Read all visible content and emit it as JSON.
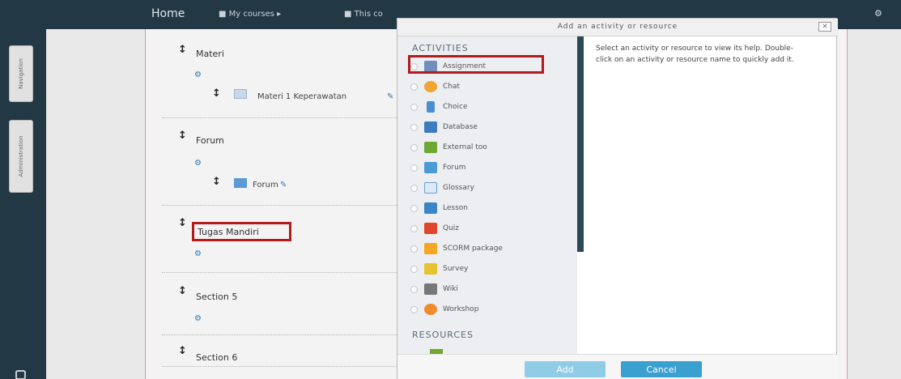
{
  "topnav": {
    "home": "Home",
    "my_courses": "My courses ▸",
    "this_course": "This co",
    "gear_icon": "gear-icon"
  },
  "rail": {
    "navigation_label": "Navigation",
    "administration_label": "Administration"
  },
  "course": {
    "sections": [
      {
        "title": "Materi",
        "item": {
          "label": "Materi 1 Keperawatan",
          "icon": "file-icon"
        }
      },
      {
        "title": "Forum",
        "item": {
          "label": "Forum",
          "icon": "forum-icon"
        }
      },
      {
        "title": "Tugas Mandiri"
      },
      {
        "title": "Section 5"
      },
      {
        "title": "Section 6"
      }
    ]
  },
  "dialog": {
    "title": "Add an activity or resource",
    "close": "✕",
    "activities_heading": "ACTIVITIES",
    "resources_heading": "RESOURCES",
    "activities": [
      {
        "label": "Assignment",
        "icon": "assignment-icon",
        "color": "#6f8fbf",
        "selected": true
      },
      {
        "label": "Chat",
        "icon": "chat-icon",
        "color": "#f0a534"
      },
      {
        "label": "Choice",
        "icon": "choice-icon",
        "color": "#4a8ed0"
      },
      {
        "label": "Database",
        "icon": "database-icon",
        "color": "#3e7cc0"
      },
      {
        "label": "External too",
        "icon": "external-tool-icon",
        "color": "#6ea834"
      },
      {
        "label": "Forum",
        "icon": "forum-icon",
        "color": "#4a9bd6"
      },
      {
        "label": "Glossary",
        "icon": "glossary-icon",
        "color": "#6aa0d8"
      },
      {
        "label": "Lesson",
        "icon": "lesson-icon",
        "color": "#3a86c8"
      },
      {
        "label": "Quiz",
        "icon": "quiz-icon",
        "color": "#e0462b"
      },
      {
        "label": "SCORM package",
        "icon": "scorm-icon",
        "color": "#f3a722"
      },
      {
        "label": "Survey",
        "icon": "survey-icon",
        "color": "#e7c231"
      },
      {
        "label": "Wiki",
        "icon": "wiki-icon",
        "color": "#777777"
      },
      {
        "label": "Workshop",
        "icon": "workshop-icon",
        "color": "#f08c2c"
      }
    ],
    "help_text": "Select an activity or resource to view its help. Double-click on an activity or resource name to quickly add it.",
    "add_button": "Add",
    "cancel_button": "Cancel"
  },
  "colors": {
    "nav_bg": "#223845",
    "highlight": "#b11b1b",
    "add_button": "#8fcde6",
    "cancel_button": "#3aa0cf"
  }
}
